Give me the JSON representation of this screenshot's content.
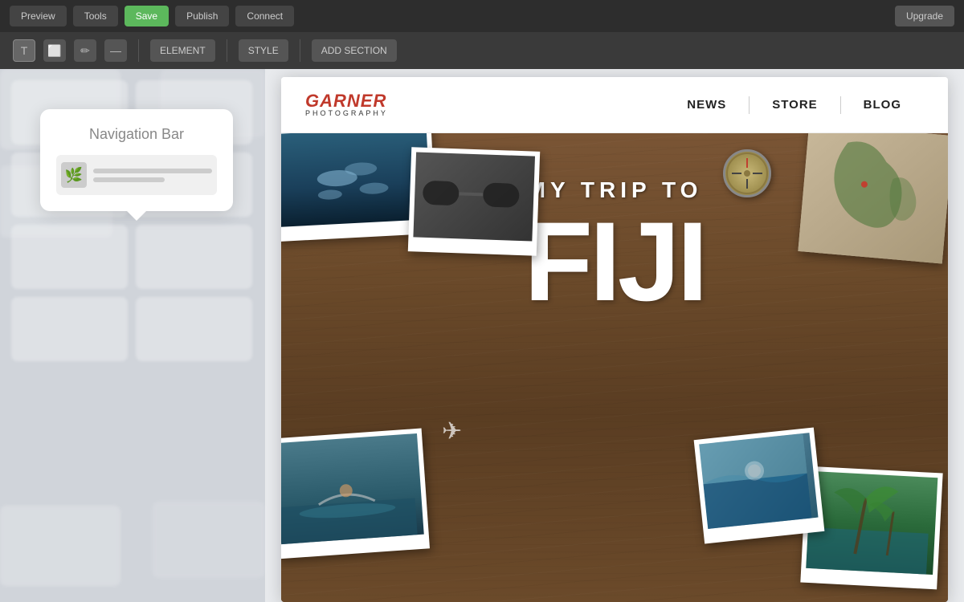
{
  "toolbar": {
    "buttons": [
      "Preview",
      "Tools",
      "Save",
      "Publish",
      "Connect"
    ],
    "active_button": "Save",
    "right_button": "Upgrade"
  },
  "secondary_toolbar": {
    "icons": [
      "T",
      "🔲",
      "✏",
      "—",
      "✦"
    ],
    "tags": [
      "ELEMENT",
      "STYLE",
      "ADD SECTION"
    ]
  },
  "featured_card": {
    "title": "Navigation Bar",
    "preview_icon": "🌿"
  },
  "website": {
    "brand_name": "GARNER",
    "brand_subtitle": "PHOTOGRAPHY",
    "nav_links": [
      "NEWS",
      "STORE",
      "BLOG"
    ],
    "hero_subtitle": "MY TRIP TO",
    "hero_title": "FIJI"
  }
}
